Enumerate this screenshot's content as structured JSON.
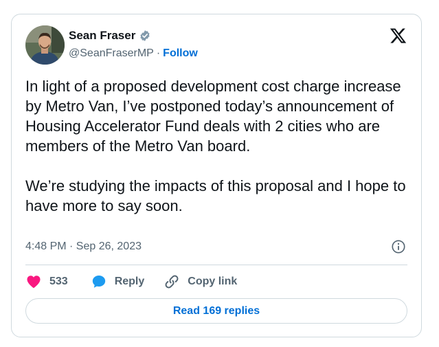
{
  "author": {
    "name": "Sean Fraser",
    "handle": "@SeanFraserMP",
    "separator": "·",
    "follow_label": "Follow",
    "verified": true
  },
  "tweet": {
    "text": "In light of a proposed development cost charge increase by Metro Van, I’ve postponed today’s announcement of Housing Accelerator Fund deals with 2 cities who are members of the Metro Van board.\n\nWe’re studying the impacts of this proposal and I hope to have more to say soon.",
    "timestamp": "4:48 PM · Sep 26, 2023"
  },
  "actions": {
    "like_count": "533",
    "reply_label": "Reply",
    "copy_label": "Copy link"
  },
  "read_replies_label": "Read 169 replies",
  "icons": {
    "logo": "x-logo-icon",
    "verified": "verified-badge-icon",
    "info": "info-icon",
    "like": "heart-icon",
    "reply": "speech-bubble-icon",
    "copy": "link-icon"
  },
  "colors": {
    "text": "#0f1419",
    "secondary": "#536471",
    "link": "#006fd6",
    "like": "#f91880",
    "reply": "#1d9bf0",
    "border": "#cfd9de"
  }
}
